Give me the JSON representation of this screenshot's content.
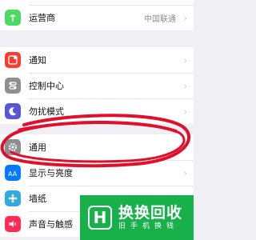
{
  "rows_top": [
    {
      "label": "运营商",
      "value": "中国联通",
      "icon": "antenna-icon",
      "color": "#4cd964"
    }
  ],
  "group_notify": [
    {
      "label": "通知",
      "icon": "notification-icon",
      "color": "#ff3b30"
    },
    {
      "label": "控制中心",
      "icon": "control-center-icon",
      "color": "#8e8e93"
    },
    {
      "label": "勿扰模式",
      "icon": "moon-icon",
      "color": "#5856d6"
    }
  ],
  "group_general": [
    {
      "label": "通用",
      "icon": "gear-icon",
      "color": "#8e8e93"
    },
    {
      "label": "显示与亮度",
      "icon": "display-brightness-icon",
      "color": "#007aff"
    },
    {
      "label": "墙纸",
      "icon": "wallpaper-icon",
      "color": "#34aadc"
    },
    {
      "label": "声音与触感",
      "icon": "sound-icon",
      "color": "#ff2d55"
    }
  ],
  "ad": {
    "logo": "H",
    "title": "换换回收",
    "subtitle": "旧手机换钱"
  },
  "colors": {
    "annotation": "#e0102a",
    "background": "#efeff4"
  }
}
